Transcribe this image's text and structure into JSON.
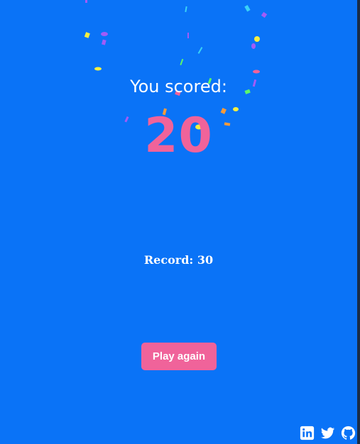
{
  "colors": {
    "background": "#0a73f7",
    "accent": "#f0639a",
    "text": "#ffffff"
  },
  "score": {
    "title": "You scored:",
    "value": "20"
  },
  "record": {
    "text": "Record: 30"
  },
  "actions": {
    "play_again_label": "Play again"
  },
  "footer": {
    "social_icons": [
      "linkedin-icon",
      "twitter-icon",
      "github-icon"
    ]
  },
  "confetti_colors": [
    "#f5ef41",
    "#a25cf7",
    "#f0639a",
    "#5df76b",
    "#f79b3a",
    "#3ad2f7"
  ]
}
